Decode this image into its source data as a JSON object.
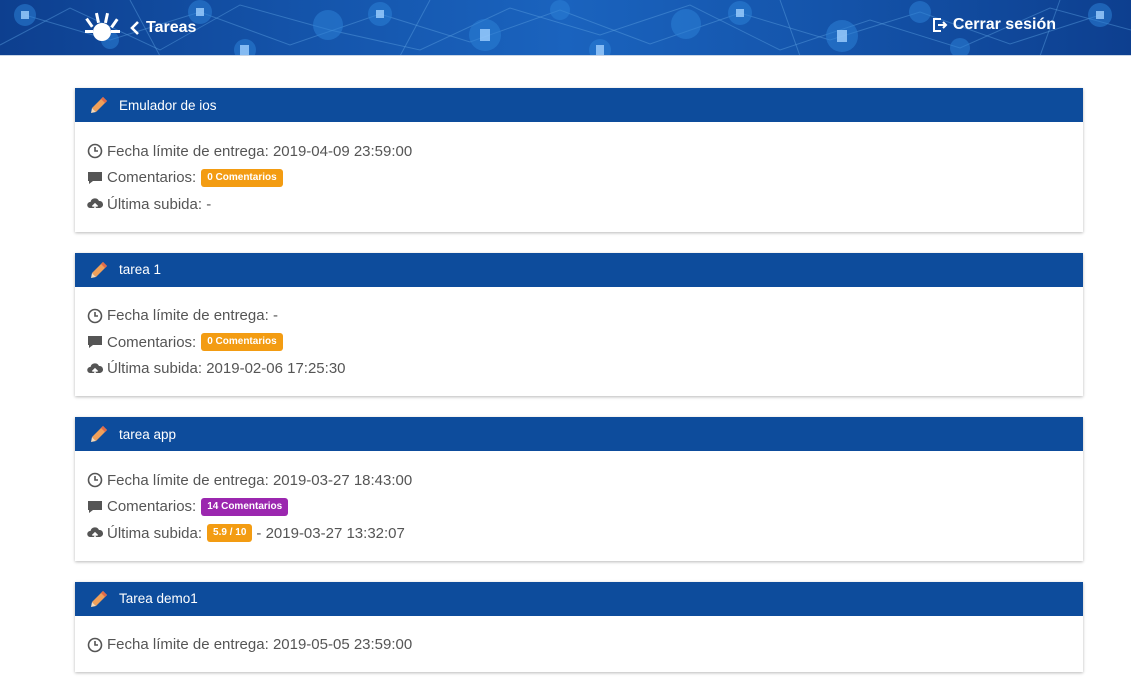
{
  "header": {
    "back_label": "Tareas",
    "logout_label": "Cerrar sesión"
  },
  "labels": {
    "deadline": "Fecha límite de entrega:",
    "comments": "Comentarios:",
    "last_upload": "Última subida:"
  },
  "colors": {
    "header_bg": "#0d4c9c",
    "badge_orange": "#f39c12",
    "badge_purple": "#9b27af"
  },
  "tasks": [
    {
      "title": "Emulador de ios",
      "deadline": "2019-04-09 23:59:00",
      "comments_badge": "0 Comentarios",
      "upload_grade": "",
      "upload_value": "-"
    },
    {
      "title": "tarea 1",
      "deadline": "-",
      "comments_badge": "0 Comentarios",
      "upload_grade": "",
      "upload_value": "2019-02-06 17:25:30"
    },
    {
      "title": "tarea app",
      "deadline": "2019-03-27 18:43:00",
      "comments_badge": "14 Comentarios",
      "upload_grade": "5.9 / 10",
      "upload_value": "- 2019-03-27 13:32:07"
    },
    {
      "title": "Tarea demo1",
      "deadline": "2019-05-05 23:59:00",
      "comments_badge": "",
      "upload_grade": "",
      "upload_value": ""
    }
  ]
}
